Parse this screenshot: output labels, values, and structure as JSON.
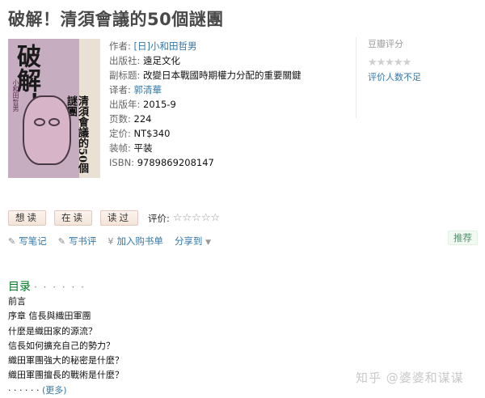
{
  "book": {
    "title": "破解！清須會議的50個謎團",
    "author_label": "作者:",
    "author": "[日]小和田哲男",
    "publisher_label": "出版社:",
    "publisher": "遠足文化",
    "subtitle_label": "副标题:",
    "subtitle": "改變日本戰國時期權力分配的重要關鍵",
    "translator_label": "译者:",
    "translator": "郭清華",
    "year_label": "出版年:",
    "year": "2015-9",
    "pages_label": "页数:",
    "pages": "224",
    "price_label": "定价:",
    "price": "NT$340",
    "binding_label": "装帧:",
    "binding": "平装",
    "isbn_label": "ISBN:",
    "isbn": "9789869208147"
  },
  "cover": {
    "big_text": "破解！",
    "sub_text": "清須會議的50個謎團",
    "author_text": "小和田哲男"
  },
  "rating": {
    "heading": "豆瓣评分",
    "stars": "★★★★★",
    "note": "评价人数不足"
  },
  "buttons": {
    "want": "想读",
    "reading": "在读",
    "read": "读过",
    "rate_label": "评价:",
    "rate_stars": "☆☆☆☆☆"
  },
  "actions": {
    "note": "写笔记",
    "review": "写书评",
    "cart": "加入购书单",
    "share": "分享到",
    "recommend": "推荐"
  },
  "toc": {
    "heading": "目录",
    "dots": "· · · · · ·",
    "items": [
      "前言",
      "序章 信長與織田軍團",
      "什麼是織田家的源流？",
      "信長如何擴充自己的勢力？",
      "織田軍團強大的秘密是什麼？",
      "織田軍團擅長的戰術是什麼？"
    ],
    "more_dots": "· · · · · ·",
    "more_label": "(更多)"
  },
  "watermark": "知乎 @婆婆和谋谋",
  "colors": {
    "link": "#3377aa",
    "toc_heading": "#007722",
    "button_bg": "#fcf4ee"
  }
}
